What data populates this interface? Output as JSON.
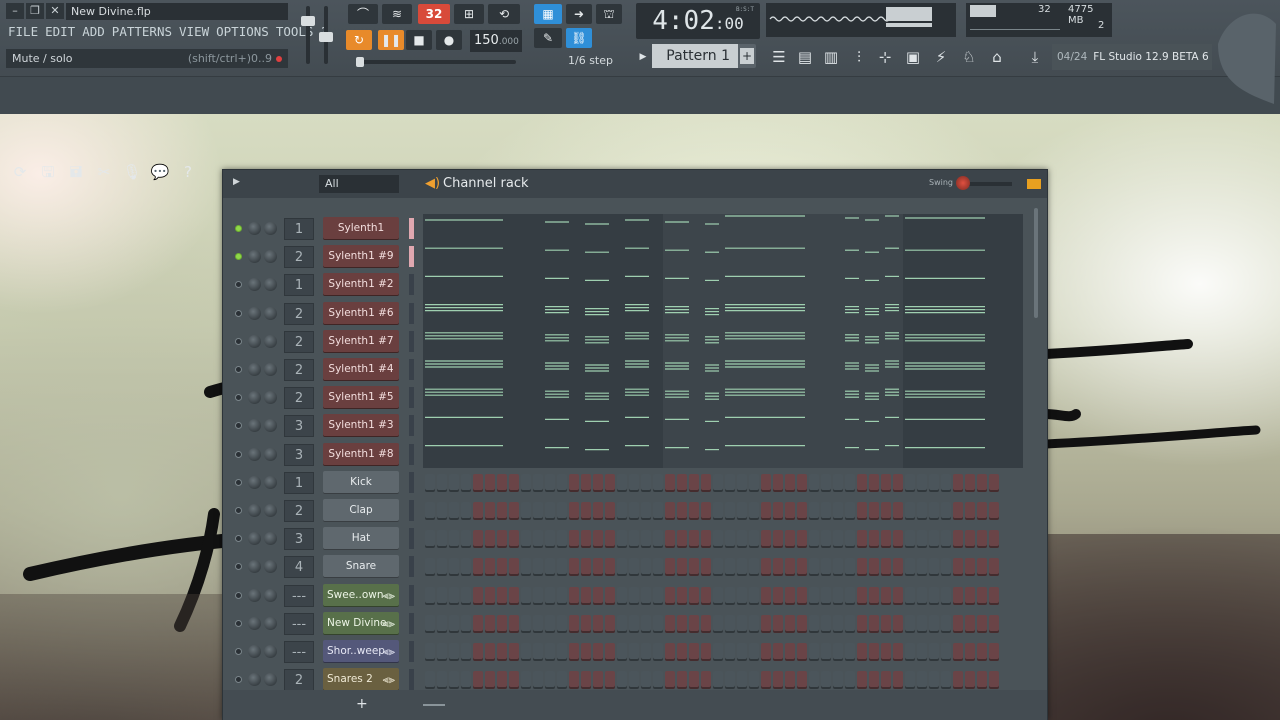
{
  "window": {
    "file_title": "New Divine.flp",
    "hint_text": "Mute / solo",
    "hint_shortcut": "(shift/ctrl+)0..9"
  },
  "menu": [
    "FILE",
    "EDIT",
    "ADD",
    "PATTERNS",
    "VIEW",
    "OPTIONS",
    "TOOLS",
    "?"
  ],
  "transport": {
    "bpm": "150",
    "bpm_decimal": ".000",
    "step": "1/6 step",
    "time_main": "4:02",
    "time_sub": ":00",
    "time_label": "B:S:T",
    "pattern": "Pattern 1",
    "pattern_plus": "+"
  },
  "cpu": {
    "value": "32",
    "memory": "4775 MB",
    "polyphony": "2"
  },
  "news": {
    "counter": "04/24",
    "text": "FL Studio 12.9 BETA 6"
  },
  "rack": {
    "filter": "All",
    "title": "Channel rack",
    "swing_label": "Swing",
    "add_label": "+",
    "channels": [
      {
        "name": "Sylenth1",
        "mixer": "1",
        "type": "syn",
        "led": true,
        "sel": true
      },
      {
        "name": "Sylenth1 #9",
        "mixer": "2",
        "type": "syn",
        "led": true,
        "sel": true
      },
      {
        "name": "Sylenth1 #2",
        "mixer": "1",
        "type": "syn",
        "led": false,
        "sel": false
      },
      {
        "name": "Sylenth1 #6",
        "mixer": "2",
        "type": "syn",
        "led": false,
        "sel": false
      },
      {
        "name": "Sylenth1 #7",
        "mixer": "2",
        "type": "syn",
        "led": false,
        "sel": false
      },
      {
        "name": "Sylenth1 #4",
        "mixer": "2",
        "type": "syn",
        "led": false,
        "sel": false
      },
      {
        "name": "Sylenth1 #5",
        "mixer": "2",
        "type": "syn",
        "led": false,
        "sel": false
      },
      {
        "name": "Sylenth1 #3",
        "mixer": "3",
        "type": "syn",
        "led": false,
        "sel": false
      },
      {
        "name": "Sylenth1 #8",
        "mixer": "3",
        "type": "syn",
        "led": false,
        "sel": false
      },
      {
        "name": "Kick",
        "mixer": "1",
        "type": "drum",
        "led": false,
        "sel": false
      },
      {
        "name": "Clap",
        "mixer": "2",
        "type": "drum",
        "led": false,
        "sel": false
      },
      {
        "name": "Hat",
        "mixer": "3",
        "type": "drum",
        "led": false,
        "sel": false
      },
      {
        "name": "Snare",
        "mixer": "4",
        "type": "drum",
        "led": false,
        "sel": false
      },
      {
        "name": "Swee..own",
        "mixer": "---",
        "type": "smp",
        "led": false,
        "sel": false
      },
      {
        "name": "New Divine",
        "mixer": "---",
        "type": "smp",
        "led": false,
        "sel": false
      },
      {
        "name": "Shor..weep",
        "mixer": "---",
        "type": "smp2",
        "led": false,
        "sel": false
      },
      {
        "name": "Snares 2",
        "mixer": "2",
        "type": "smp3",
        "led": false,
        "sel": false
      }
    ]
  },
  "icons": {
    "wave": "waveform-icon",
    "speaker": "speaker-icon"
  }
}
